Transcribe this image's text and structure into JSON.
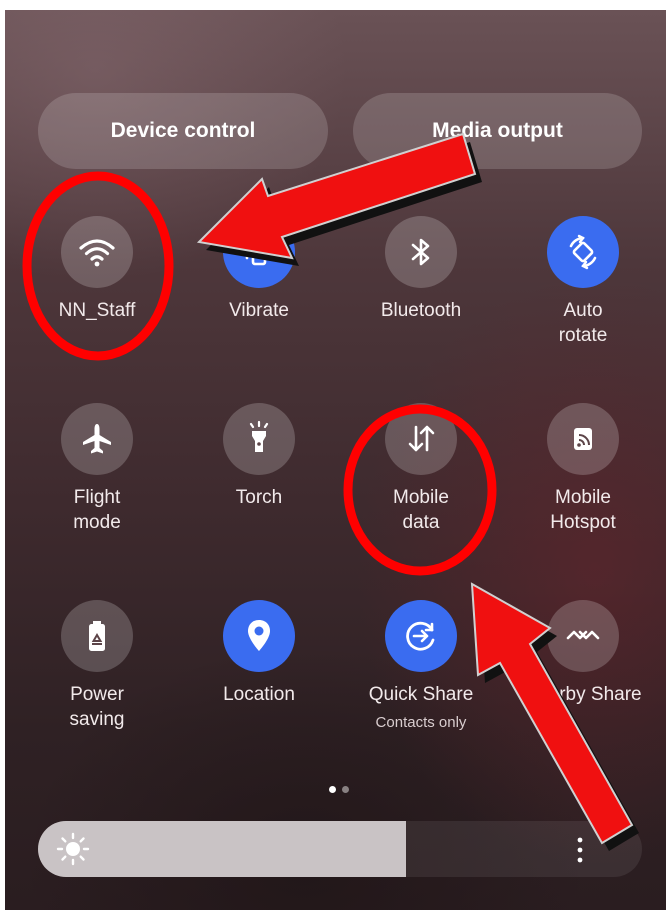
{
  "header_buttons": {
    "device_control": "Device control",
    "media_output": "Media output"
  },
  "tiles": [
    {
      "label": "NN_Staff",
      "icon": "wifi-icon",
      "active": true
    },
    {
      "label": "Vibrate",
      "icon": "vibrate-icon",
      "active": true
    },
    {
      "label": "Bluetooth",
      "icon": "bluetooth-icon",
      "active": false
    },
    {
      "label": "Auto\nrotate",
      "icon": "auto-rotate-icon",
      "active": true
    },
    {
      "label": "Flight\nmode",
      "icon": "airplane-icon",
      "active": false
    },
    {
      "label": "Torch",
      "icon": "torch-icon",
      "active": false
    },
    {
      "label": "Mobile\ndata",
      "icon": "mobile-data-icon",
      "active": false
    },
    {
      "label": "Mobile\nHotspot",
      "icon": "hotspot-icon",
      "active": false
    },
    {
      "label": "Power\nsaving",
      "icon": "battery-icon",
      "active": false
    },
    {
      "label": "Location",
      "icon": "location-icon",
      "active": true
    },
    {
      "label": "Quick Share",
      "sublabel": "Contacts only",
      "icon": "quick-share-icon",
      "active": true
    },
    {
      "label": "Nearby Share",
      "icon": "nearby-share-icon",
      "active": false
    }
  ],
  "pagination": {
    "current": 1,
    "total": 2
  },
  "brightness": {
    "level": 0.61
  },
  "colors": {
    "active_tile": "#3a6cf0",
    "annotation": "#ff0000"
  },
  "annotations": [
    "red-arrow",
    "red-circle"
  ]
}
